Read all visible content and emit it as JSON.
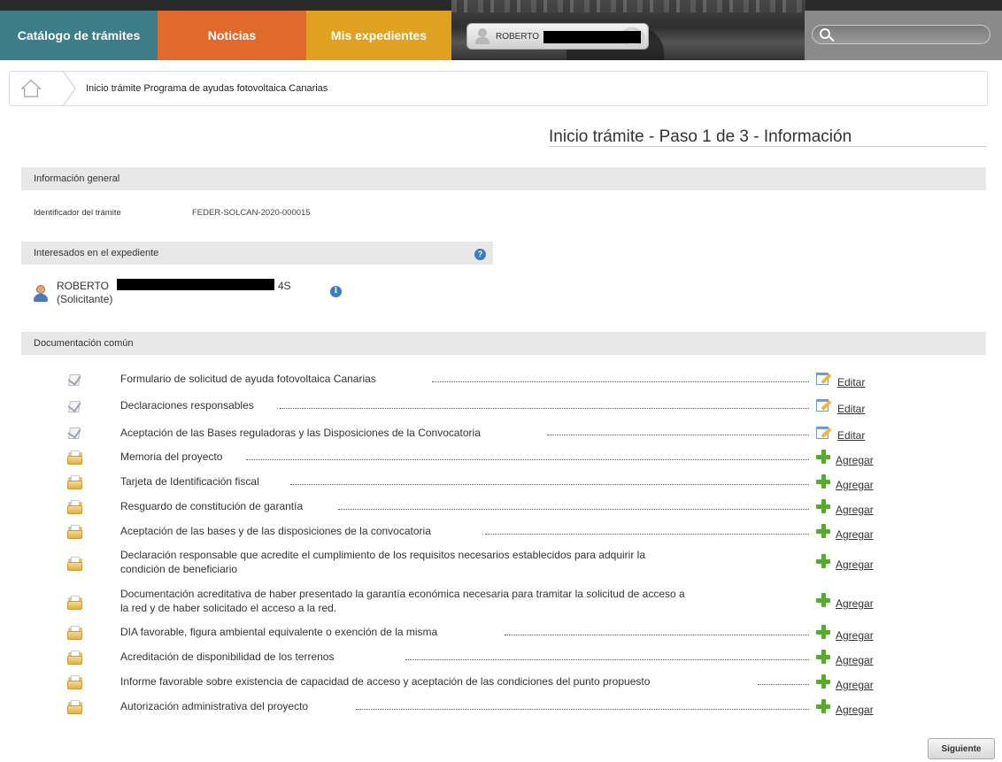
{
  "nav": {
    "tabs": [
      {
        "label": "Catálogo de trámites",
        "color": "#3c7d88"
      },
      {
        "label": "Noticias",
        "color": "#e06a2c"
      },
      {
        "label": "Mis expedientes",
        "color": "#e0a020"
      }
    ],
    "user_name": "ROBERTO",
    "search_placeholder": ""
  },
  "breadcrumb": {
    "home_icon": "home-icon",
    "current": "Inicio trámite Programa de ayudas fotovoltaica Canarias"
  },
  "page": {
    "title": "Inicio trámite - Paso 1 de 3 - Información"
  },
  "general": {
    "header": "Información general",
    "id_label": "Identificador del trámite",
    "id_value": "FEDER-SOLCAN-2020-000015"
  },
  "interesados": {
    "header": "Interesados en el expediente",
    "help_icon": "?",
    "person_name": "ROBERTO",
    "person_suffix": "4S",
    "person_role": "(Solicitante)",
    "info_icon": "i"
  },
  "documentacion": {
    "header": "Documentación común",
    "items": [
      {
        "label": "Formulario de solicitud de ayuda fotovoltaica Canarias",
        "status": "done",
        "action": "Editar"
      },
      {
        "label": "Declaraciones responsables",
        "status": "done",
        "action": "Editar"
      },
      {
        "label": "Aceptación de las Bases reguladoras y las Disposiciones de la Convocatoria",
        "status": "done",
        "action": "Editar"
      },
      {
        "label": "Memoria del proyecto",
        "status": "pending",
        "action": "Agregar"
      },
      {
        "label": "Tarjeta de Identificación fiscal",
        "status": "pending",
        "action": "Agregar"
      },
      {
        "label": "Resguardo de constitución de garantía",
        "status": "pending",
        "action": "Agregar"
      },
      {
        "label": "Aceptación de las bases y de las disposiciones de la convocatoria",
        "status": "pending",
        "action": "Agregar"
      },
      {
        "label_line1": "Declaración responsable que acredite el cumplimiento de los requisitos necesarios establecidos para adquirir la",
        "label_line2": "condición de beneficiario",
        "status": "pending",
        "action": "Agregar"
      },
      {
        "label_line1": "Documentación acreditativa de haber presentado la garantía económica necesaria para tramitar la solicitud de acceso a",
        "label_line2": "la red y de haber solicitado el acceso a la red.",
        "status": "pending",
        "action": "Agregar"
      },
      {
        "label": "DIA favorable, figura ambiental equivalente o exención de la misma",
        "status": "pending",
        "action": "Agregar"
      },
      {
        "label": "Acreditación de disponibilidad de los terrenos",
        "status": "pending",
        "action": "Agregar"
      },
      {
        "label": "Informe favorable sobre existencia de capacidad de acceso y aceptación de las condiciones del punto propuesto",
        "status": "pending",
        "action": "Agregar"
      },
      {
        "label": "Autorización administrativa del proyecto",
        "status": "pending",
        "action": "Agregar"
      }
    ]
  },
  "footer": {
    "next_label": "Siguiente"
  }
}
